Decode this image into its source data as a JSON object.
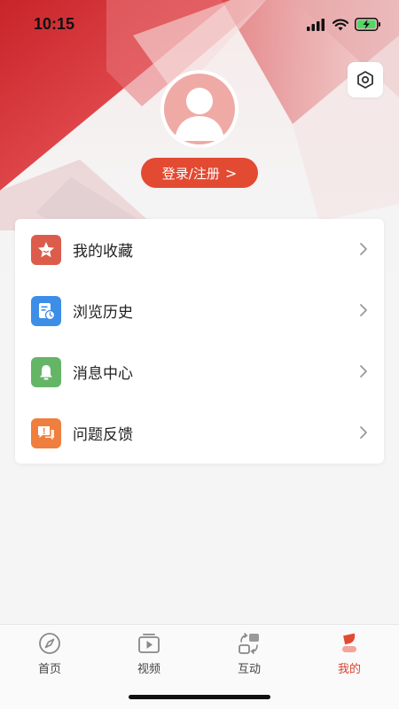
{
  "status_bar": {
    "time": "10:15",
    "icons": [
      "signal-icon",
      "wifi-icon",
      "battery-charging-icon"
    ]
  },
  "profile": {
    "login_label": "登录/注册",
    "login_chevron": ">"
  },
  "menu": {
    "items": [
      {
        "label": "我的收藏",
        "icon": "star-icon",
        "color": "#dc5c4c"
      },
      {
        "label": "浏览历史",
        "icon": "history-icon",
        "color": "#3d8ee6"
      },
      {
        "label": "消息中心",
        "icon": "bell-icon",
        "color": "#64b566"
      },
      {
        "label": "问题反馈",
        "icon": "feedback-icon",
        "color": "#ef7f3e"
      }
    ]
  },
  "tabs": [
    {
      "label": "首页",
      "icon": "compass-icon",
      "active": false
    },
    {
      "label": "视频",
      "icon": "video-icon",
      "active": false
    },
    {
      "label": "互动",
      "icon": "interact-icon",
      "active": false
    },
    {
      "label": "我的",
      "icon": "profile-icon",
      "active": true
    }
  ],
  "colors": {
    "accent": "#e24a32",
    "active_tab": "#d9432f"
  }
}
